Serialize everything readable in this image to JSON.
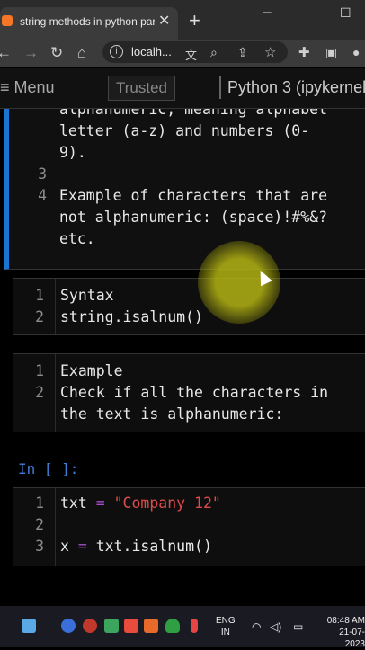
{
  "browser": {
    "tab_title": "string methods in python part",
    "tab_close": "✕",
    "new_tab": "+",
    "min": "−",
    "max": "☐",
    "url": "localh..."
  },
  "toolbar": {
    "menu_label": "≡ Menu",
    "trusted_label": "Trusted",
    "kernel_label": "Python 3 (ipykernel"
  },
  "cells": [
    {
      "id": "cell1",
      "lines": [
        {
          "n": "",
          "text": "alphanumeric, meaning alphabet"
        },
        {
          "n": "",
          "text": "letter (a-z) and numbers (0-"
        },
        {
          "n": "",
          "text": "9)."
        },
        {
          "n": "3",
          "text": ""
        },
        {
          "n": "4",
          "text": "Example of characters that are"
        },
        {
          "n": "",
          "text": "not alphanumeric: (space)!#%&?"
        },
        {
          "n": "",
          "text": "etc."
        }
      ]
    },
    {
      "id": "cell2",
      "lines": [
        {
          "n": "1",
          "text": "Syntax"
        },
        {
          "n": "2",
          "text": "string.isalnum()"
        }
      ]
    },
    {
      "id": "cell3",
      "lines": [
        {
          "n": "1",
          "text": "Example"
        },
        {
          "n": "2",
          "text": "Check if all the characters in"
        },
        {
          "n": "",
          "text": "the text is alphanumeric:"
        }
      ]
    }
  ],
  "prompt": "In [ ]:",
  "code_cell": {
    "lines": [
      {
        "n": "1",
        "a": "txt ",
        "op": "=",
        "b": " ",
        "str": "\"Company 12\"",
        "c": ""
      },
      {
        "n": "2",
        "a": "",
        "op": "",
        "b": "",
        "str": "",
        "c": ""
      },
      {
        "n": "3",
        "a": "x ",
        "op": "=",
        "b": " txt.isalnum()",
        "str": "",
        "c": ""
      }
    ]
  },
  "taskbar": {
    "lang_1": "ENG",
    "lang_2": "IN",
    "time": "08:48 AM",
    "date": "21-07-2023"
  },
  "colors": {
    "accent": "#1976d2",
    "keyword": "#a64dcb",
    "string": "#e04a4a",
    "prompt": "#3f7fd6"
  }
}
